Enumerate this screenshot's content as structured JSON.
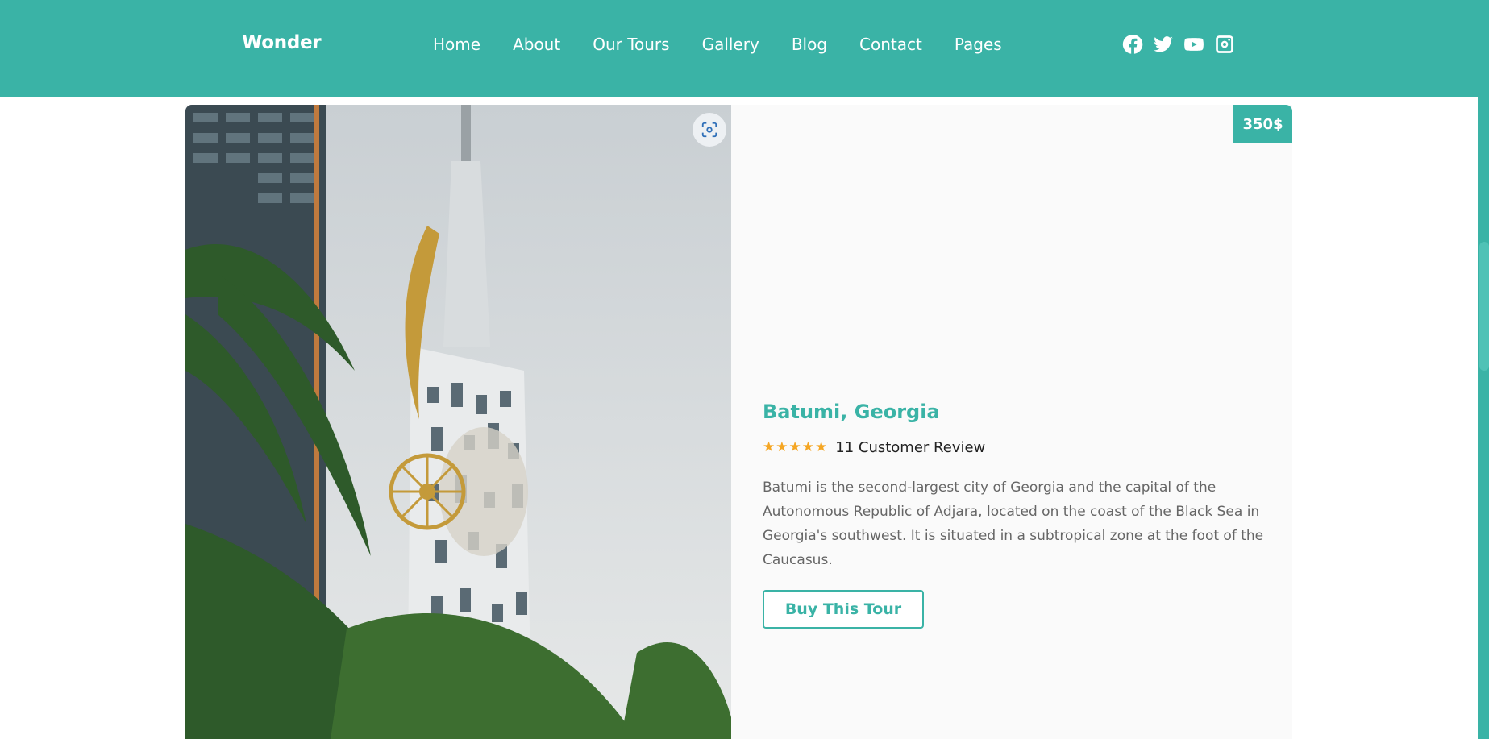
{
  "header": {
    "logo": "Wonder",
    "nav": [
      "Home",
      "About",
      "Our Tours",
      "Gallery",
      "Blog",
      "Contact",
      "Pages"
    ],
    "social": [
      "facebook-icon",
      "twitter-icon",
      "youtube-icon",
      "instagram-icon"
    ],
    "background": "#3ab3a6"
  },
  "tour": {
    "price": "350$",
    "title": "Batumi, Georgia",
    "rating": 5,
    "reviews_label": "11 Customer Review",
    "description": "Batumi is the second-largest city of Georgia and the capital of the Autonomous Republic of Adjara, located on the coast of the Black Sea in Georgia's southwest. It is situated in a subtropical zone at the foot of the Caucasus.",
    "button_label": "Buy This Tour",
    "accent": "#3ab3a6",
    "star_color": "#f5a623"
  }
}
